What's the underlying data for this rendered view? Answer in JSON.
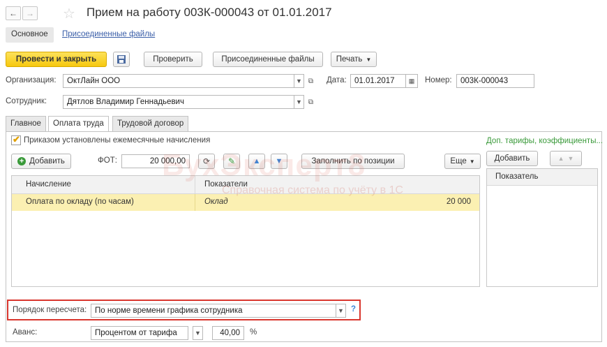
{
  "header": {
    "title": "Прием на работу 003К-000043 от 01.01.2017"
  },
  "subtabs": {
    "main": "Основное",
    "files": "Присоединенные файлы"
  },
  "toolbar": {
    "post_close": "Провести и закрыть",
    "check": "Проверить",
    "attached_files": "Присоединенные файлы",
    "print": "Печать"
  },
  "form": {
    "org_label": "Организация:",
    "org_value": "ОктЛайн ООО",
    "date_label": "Дата:",
    "date_value": "01.01.2017",
    "number_label": "Номер:",
    "number_value": "003К-000043",
    "employee_label": "Сотрудник:",
    "employee_value": "Дятлов Владимир Геннадьевич"
  },
  "tabs": [
    "Главное",
    "Оплата труда",
    "Трудовой договор"
  ],
  "pay": {
    "checkbox_label": "Приказом установлены ежемесячные начисления",
    "add_label": "Добавить",
    "fot_label": "ФОТ:",
    "fot_value": "20 000,00",
    "fill_label": "Заполнить по позиции",
    "more_label": "Еще",
    "grid_headers": [
      "Начисление",
      "Показатели"
    ],
    "rows": [
      {
        "accrual": "Оплата по окладу (по часам)",
        "indicator": "Оклад",
        "value": "20 000"
      }
    ],
    "recalc_label": "Порядок пересчета:",
    "recalc_value": "По норме времени графика сотрудника",
    "help": "?",
    "advance_label": "Аванс:",
    "advance_mode": "Процентом от тарифа",
    "advance_value": "40,00",
    "advance_unit": "%"
  },
  "right_panel": {
    "title": "Доп. тарифы, коэффициенты...",
    "add_label": "Добавить",
    "header": "Показатель"
  },
  "watermark": {
    "brand": "БухЭксперт8",
    "subtitle": "Справочная система по учёту в 1С"
  },
  "colors": {
    "accent_yellow": "#f6c80f",
    "selected_row": "#fbf0b2",
    "link": "#3a5ea8",
    "green_title": "#3a9a3a",
    "highlight_red": "#d9362e",
    "blue_arrow": "#3c86d8"
  }
}
